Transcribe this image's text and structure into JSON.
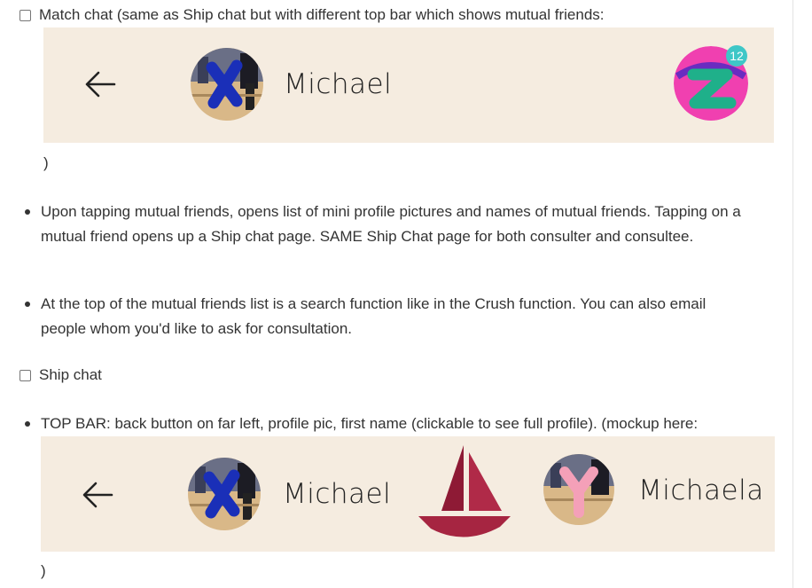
{
  "items": {
    "match_chat_label": "Match chat (same as Ship chat but with different top bar which shows mutual friends:",
    "match_chat_close": ")",
    "bullet1": "Upon tapping mutual friends, opens list of mini profile pictures and names of mutual friends. Tapping on a mutual friend opens up a Ship chat page. SAME Ship Chat page for both consulter and consultee.",
    "bullet2": "At the top of the mutual friends list is a search function like in the Crush function. You can also email people whom you'd like to ask for consultation.",
    "ship_chat_label": "Ship chat",
    "bullet3": "TOP BAR: back button on far left, profile pic, first name (clickable to see full profile). (mockup here:",
    "ship_chat_close": ")"
  },
  "match_mockup": {
    "name": "Michael",
    "badge_count": "12",
    "back_icon": "back-arrow-icon",
    "avatar_letter_icon": "x-letter-icon",
    "mutual_icon": "z-letter-icon"
  },
  "ship_mockup": {
    "name_left": "Michael",
    "name_right": "Michaela",
    "back_icon": "back-arrow-icon",
    "ship_icon": "sailboat-icon"
  },
  "colors": {
    "mockup_bg": "#f5ece0",
    "badge_teal": "#3ec7c7",
    "mutual_pink": "#f040b0",
    "mutual_letter": "#1fb08a",
    "ship_red": "#8e1a35",
    "avatar_x_blue": "#1a2fb8",
    "avatar_y_pink": "#f4a0b8"
  }
}
